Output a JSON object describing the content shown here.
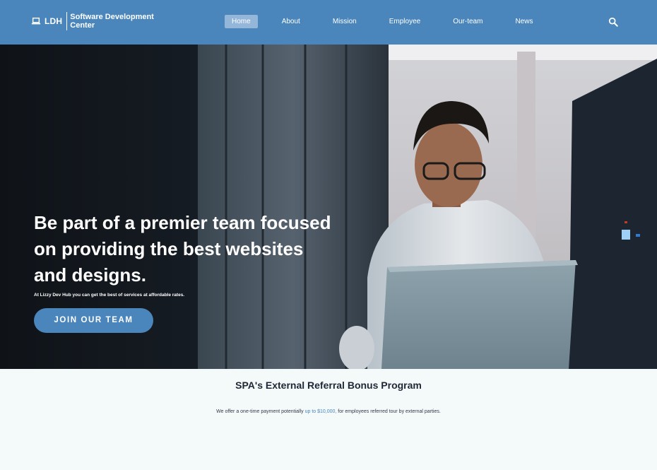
{
  "brand": {
    "abbr": "LDH",
    "name": "Software Development Center",
    "icon": "laptop-icon"
  },
  "nav": {
    "items": [
      "Home",
      "About",
      "Mission",
      "Employee",
      "Our-team",
      "News"
    ],
    "active": "Home"
  },
  "search": {
    "icon": "search-icon"
  },
  "hero": {
    "heading": "Be part of a premier team focused on providing the best websites and designs.",
    "subtext": "At Lizzy Dev Hub you can get the best of services at affordable rates.",
    "cta_label": "JOIN OUR TEAM"
  },
  "referral": {
    "title": "SPA's External Referral Bonus Program",
    "text_before": "We offer a one-time payment potentially ",
    "text_highlight": "up to $10,000,",
    "text_after": " for employees referred tour by external parties."
  },
  "colors": {
    "primary": "#4a86bb",
    "active_nav": "#93b6d9",
    "title_text": "#1f2736"
  }
}
